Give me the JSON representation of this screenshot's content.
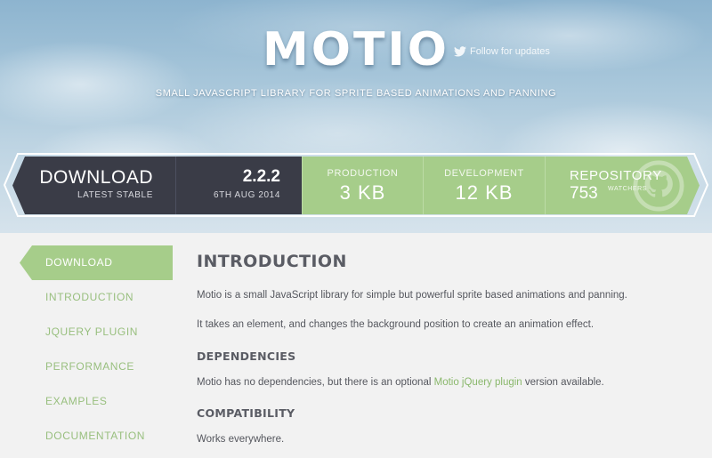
{
  "header": {
    "logo": "MOTIO",
    "follow_text": "Follow for updates",
    "tagline": "SMALL JAVASCRIPT LIBRARY FOR SPRITE BASED ANIMATIONS AND PANNING"
  },
  "ribbon": {
    "download": {
      "title": "DOWNLOAD",
      "subtitle": "LATEST STABLE"
    },
    "version": {
      "number": "2.2.2",
      "date": "6TH AUG 2014"
    },
    "production": {
      "label": "PRODUCTION",
      "value": "3 KB"
    },
    "development": {
      "label": "DEVELOPMENT",
      "value": "12 KB"
    },
    "repository": {
      "label": "REPOSITORY",
      "count": "753",
      "unit": "WATCHERS"
    }
  },
  "sidebar": {
    "items": [
      {
        "label": "DOWNLOAD",
        "active": true
      },
      {
        "label": "INTRODUCTION"
      },
      {
        "label": "JQUERY PLUGIN"
      },
      {
        "label": "PERFORMANCE"
      },
      {
        "label": "EXAMPLES"
      },
      {
        "label": "DOCUMENTATION"
      }
    ]
  },
  "content": {
    "title": "INTRODUCTION",
    "para1": "Motio is a small JavaScript library for simple but powerful sprite based animations and panning.",
    "para2": "It takes an element, and changes the background position to create an animation effect.",
    "dependencies_heading": "DEPENDENCIES",
    "dependencies_before": "Motio has no dependencies, but there is an optional ",
    "dependencies_link": "Motio jQuery plugin",
    "dependencies_after": " version available.",
    "compatibility_heading": "COMPATIBILITY",
    "compatibility_text": "Works everywhere."
  },
  "colors": {
    "accent_green": "#a6cd8a",
    "dark_bar": "#3a3c47",
    "link_green": "#8ab86c",
    "page_bg": "#f2f2f2"
  },
  "icons": {
    "follow": "twitter-bird-icon",
    "repository": "github-octocat-icon"
  }
}
